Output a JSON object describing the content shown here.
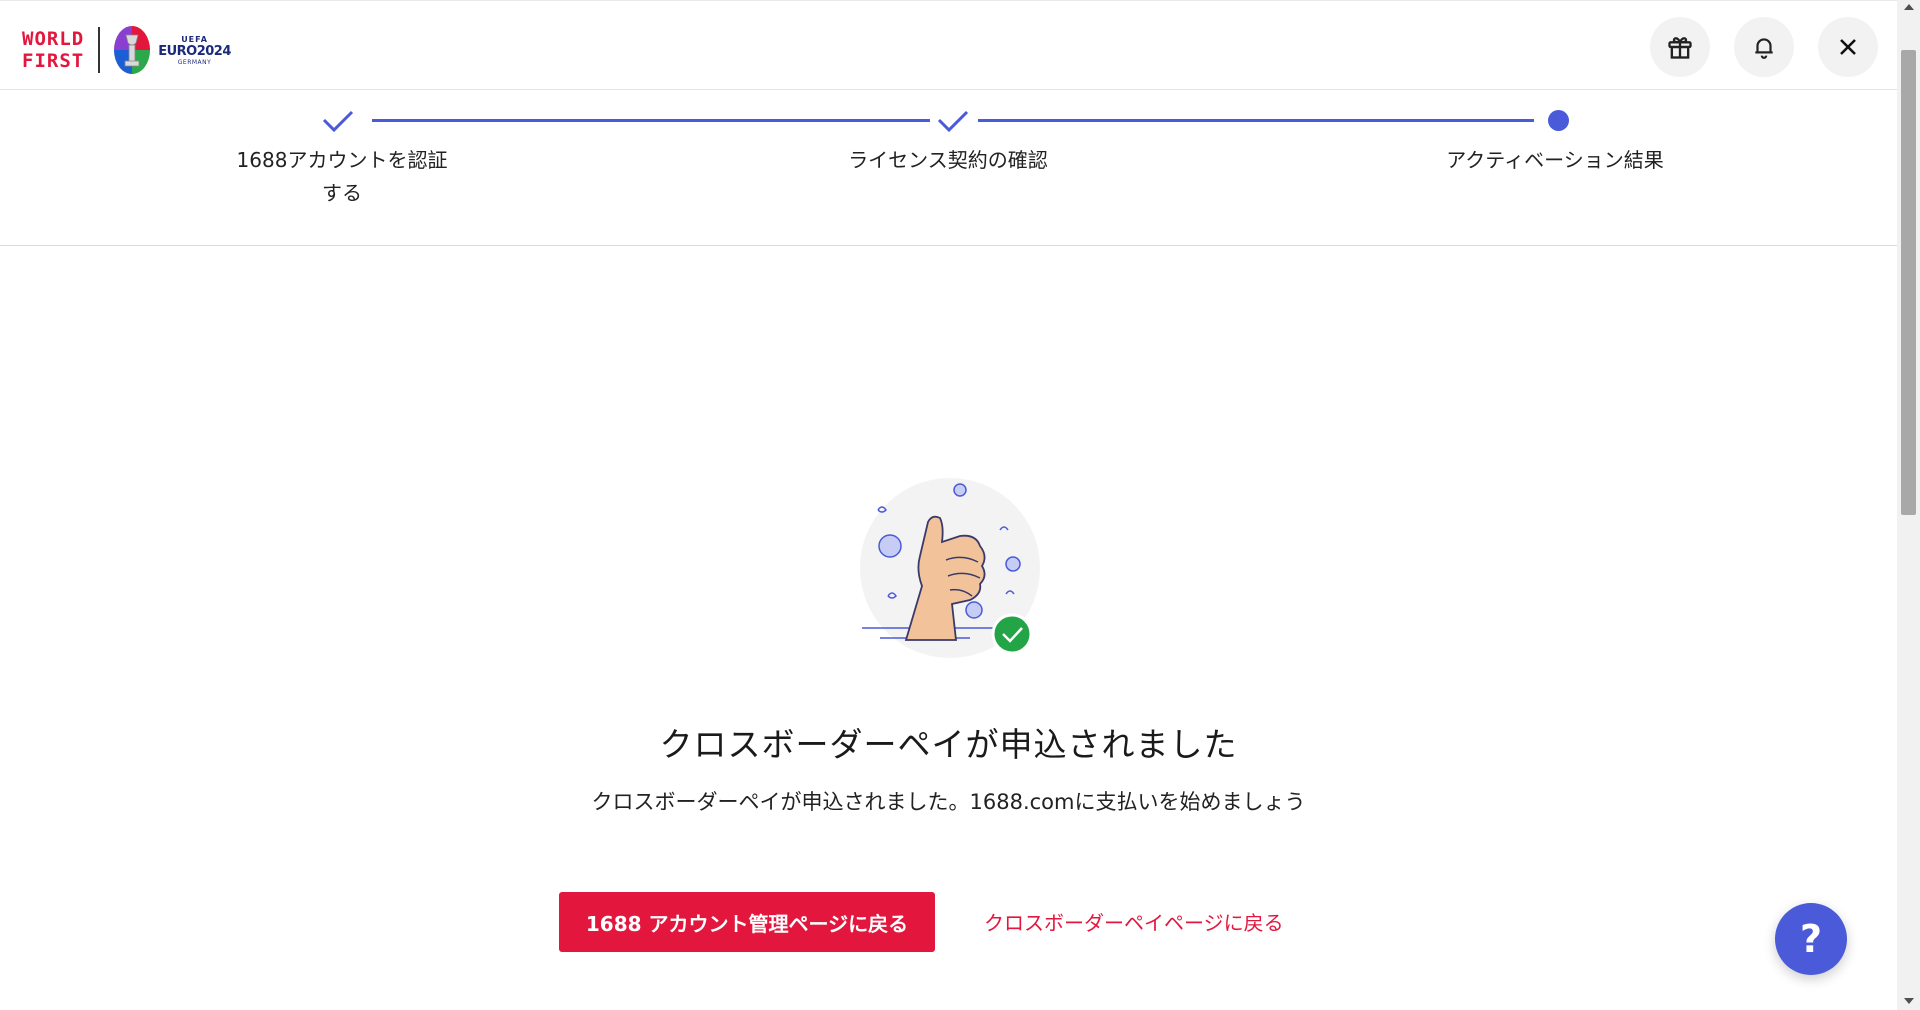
{
  "header": {
    "logo_line1": "WORLD",
    "logo_line2": "FIRST",
    "euro_uefa": "UEFA",
    "euro_name": "EURO2024",
    "euro_country": "GERMANY",
    "icons": [
      "gift-icon",
      "bell-icon",
      "close-icon"
    ]
  },
  "steps": [
    {
      "label": "1688アカウントを認証する",
      "status": "done"
    },
    {
      "label": "ライセンス契約の確認",
      "status": "done"
    },
    {
      "label": "アクティベーション結果",
      "status": "current"
    }
  ],
  "result": {
    "title": "クロスボーダーペイが申込されました",
    "subtitle": "クロスボーダーペイが申込されました。1688.comに支払いを始めましょう",
    "primary_button": "1688 アカウント管理ページに戻る",
    "secondary_link": "クロスボーダーペイページに戻る"
  },
  "help": {
    "label": "?"
  },
  "colors": {
    "brand_red": "#e3173e",
    "accent_blue": "#4a5ad8",
    "success_green": "#22a447"
  }
}
